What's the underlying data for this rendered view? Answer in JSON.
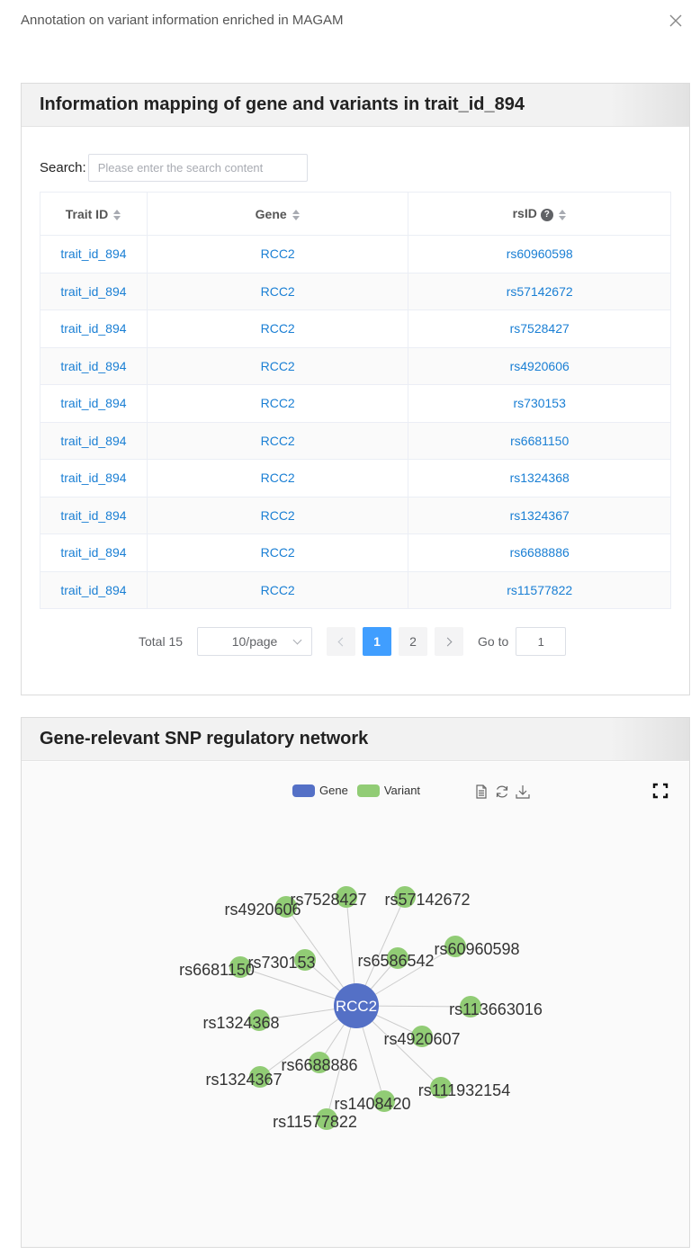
{
  "dialog": {
    "title": "Annotation on variant information enriched in MAGAM",
    "close_icon": "close-icon"
  },
  "mapping": {
    "title": "Information mapping of gene and variants in trait_id_894",
    "search_label": "Search:",
    "search_placeholder": "Please enter the search content",
    "search_value": "",
    "columns": [
      "Trait ID",
      "Gene",
      "rsID"
    ],
    "rows": [
      [
        "trait_id_894",
        "RCC2",
        "rs60960598"
      ],
      [
        "trait_id_894",
        "RCC2",
        "rs57142672"
      ],
      [
        "trait_id_894",
        "RCC2",
        "rs7528427"
      ],
      [
        "trait_id_894",
        "RCC2",
        "rs4920606"
      ],
      [
        "trait_id_894",
        "RCC2",
        "rs730153"
      ],
      [
        "trait_id_894",
        "RCC2",
        "rs6681150"
      ],
      [
        "trait_id_894",
        "RCC2",
        "rs1324368"
      ],
      [
        "trait_id_894",
        "RCC2",
        "rs1324367"
      ],
      [
        "trait_id_894",
        "RCC2",
        "rs6688886"
      ],
      [
        "trait_id_894",
        "RCC2",
        "rs11577822"
      ]
    ],
    "pagination": {
      "total": "Total 15",
      "page_size": "10/page",
      "pages": [
        "1",
        "2"
      ],
      "current_page": "1",
      "goto_label": "Go to",
      "goto_value": "1"
    }
  },
  "network": {
    "title": "Gene-relevant SNP regulatory network",
    "legend": [
      {
        "label": "Gene",
        "color": "#5470c6"
      },
      {
        "label": "Variant",
        "color": "#91cc75"
      }
    ],
    "toolbar_icons": [
      "data-view-icon",
      "restore-icon",
      "download-icon"
    ],
    "fullscreen_icon": "fullscreen-icon",
    "gene": {
      "name": "RCC2",
      "color": "#5470c6"
    },
    "variants": [
      "rs7528427",
      "rs57142672",
      "rs4920606",
      "rs60960598",
      "rs6586542",
      "rs730153",
      "rs6681150",
      "rs113663016",
      "rs1324368",
      "rs4920607",
      "rs6688886",
      "rs1324367",
      "rs111932154",
      "rs1408420",
      "rs11577822"
    ],
    "variant_color": "#91cc75",
    "edge_color": "#cccccc"
  }
}
